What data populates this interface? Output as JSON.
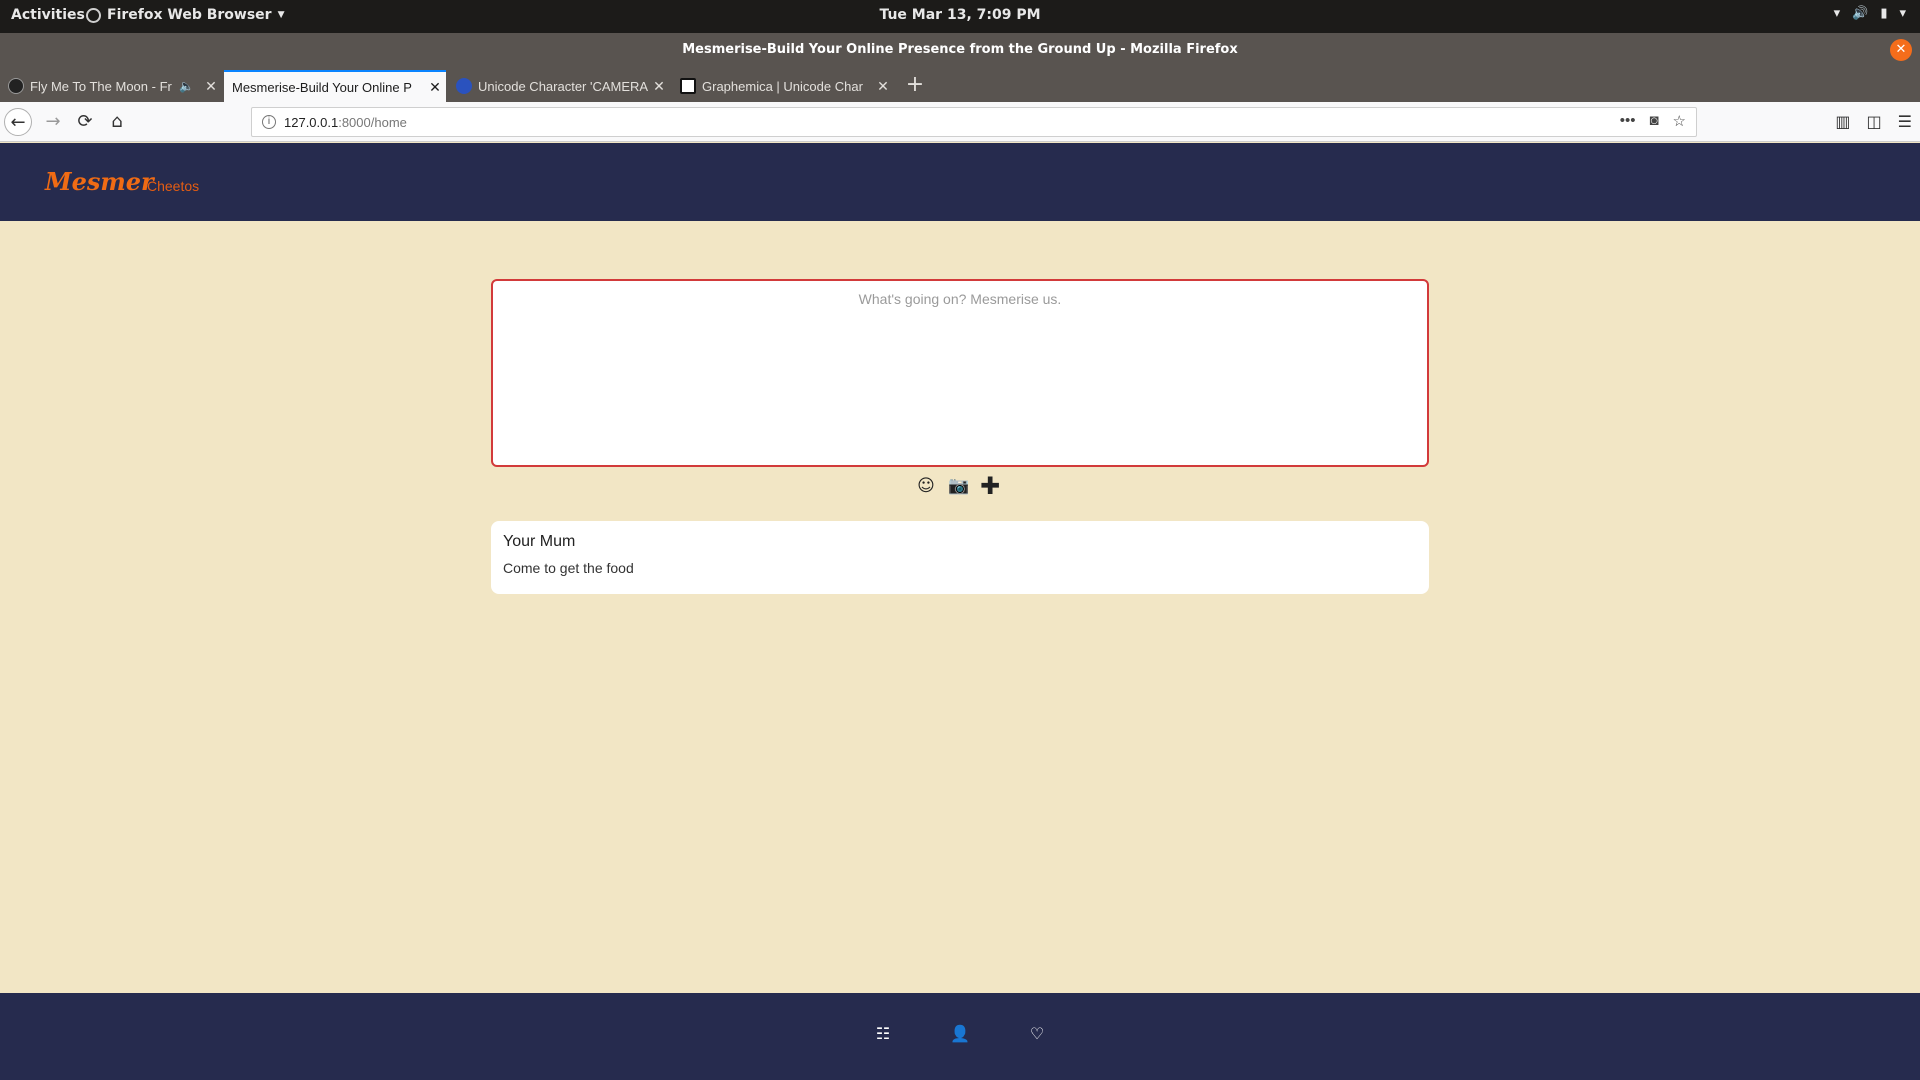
{
  "system_bar": {
    "activities": "Activities",
    "app_name": "Firefox Web Browser",
    "clock": "Tue Mar 13,  7:09 PM"
  },
  "window": {
    "title": "Mesmerise-Build Your Online Presence from the Ground Up - Mozilla Firefox",
    "close_glyph": "✕"
  },
  "tabs": [
    {
      "label": "Fly Me To The Moon - Fr",
      "favicon_color": "#222222",
      "audio": true
    },
    {
      "label": "Mesmerise-Build Your Online P",
      "favicon_color": "",
      "active": true
    },
    {
      "label": "Unicode Character 'CAMERA",
      "favicon_color": "#2a52be"
    },
    {
      "label": "Graphemica | Unicode Char",
      "favicon_color": "#111111"
    }
  ],
  "tab_close_glyph": "✕",
  "newtab_glyph": "+",
  "navbar": {
    "back": "←",
    "forward": "→",
    "reload": "⟳",
    "home": "⌂",
    "url_host": "127.0.0.1",
    "url_path": ":8000/home",
    "info_glyph": "i",
    "more_glyph": "•••",
    "pocket_glyph": "◙",
    "bookmark_glyph": "☆",
    "library_glyph": "▥",
    "sidebar_glyph": "◫",
    "menu_glyph": "☰"
  },
  "app": {
    "brand": "Mesmer",
    "username": "Cheetos",
    "brand_color": "#f06b14",
    "header_color": "#262b4e"
  },
  "compose": {
    "placeholder": "What's going on? Mesmerise us.",
    "emoji_glyph": "☺",
    "camera_glyph": "📷",
    "add_glyph": "✚"
  },
  "posts": [
    {
      "author": "Your Mum",
      "body": "Come to get the food"
    }
  ],
  "bottom_nav": {
    "feed_glyph": "☷",
    "profile_glyph": "👤",
    "likes_glyph": "♡"
  }
}
